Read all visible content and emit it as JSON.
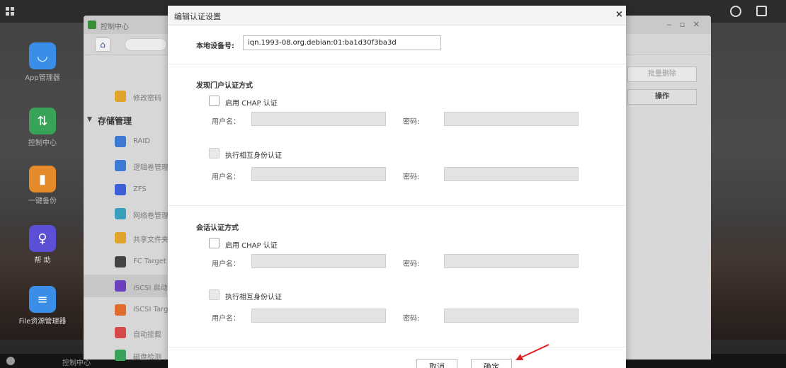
{
  "desktop": {
    "dock": [
      {
        "label": "App管理器",
        "icon": "app-store-icon",
        "color": "#3a8ee8"
      },
      {
        "label": "控制中心",
        "icon": "control-center-icon",
        "color": "#3aa35a"
      },
      {
        "label": "一键备份",
        "icon": "backup-icon",
        "color": "#e58a2a"
      },
      {
        "label": "帮 助",
        "icon": "help-icon",
        "color": "#5b4fd6"
      },
      {
        "label": "File资源管理器",
        "icon": "file-manager-icon",
        "color": "#3a8ee8"
      }
    ],
    "taskbar_label": "控制中心"
  },
  "control_center": {
    "title": "控制中心",
    "sidebar": {
      "top_item": "修改密码",
      "group": "存储管理",
      "items": [
        {
          "label": "RAID",
          "color": "#3d7ad6"
        },
        {
          "label": "逻辑卷管理",
          "color": "#3d7ad6"
        },
        {
          "label": "ZFS",
          "color": "#3d5fd6"
        },
        {
          "label": "网络卷管理",
          "color": "#3a9fbd"
        },
        {
          "label": "共享文件夹",
          "color": "#e0a42e"
        },
        {
          "label": "FC Target",
          "color": "#444444"
        },
        {
          "label": "iSCSI 启动器",
          "color": "#6b3fc0"
        },
        {
          "label": "iSCSI Target",
          "color": "#e06b2e"
        },
        {
          "label": "自动挂载",
          "color": "#d64a4a"
        },
        {
          "label": "磁盘检测",
          "color": "#3aa35a"
        }
      ]
    },
    "right_buttons": {
      "batch_delete": "批量删除",
      "operations": "操作"
    }
  },
  "dialog": {
    "title": "编辑认证设置",
    "local_device_label": "本地设备号:",
    "local_device_value": "iqn.1993-08.org.debian:01:ba1d30f3ba3d",
    "discovery_section": {
      "title": "发现门户认证方式",
      "chap_label": "启用 CHAP 认证",
      "mutual_label": "执行相互身份认证",
      "username_label": "用户名：",
      "password_label": "密码:"
    },
    "session_section": {
      "title": "会话认证方式",
      "chap_label": "启用 CHAP 认证",
      "mutual_label": "执行相互身份认证",
      "username_label": "用户名：",
      "password_label": "密码:"
    },
    "cancel_label": "取消",
    "confirm_label": "确定",
    "annotation_color": "#e02020"
  }
}
